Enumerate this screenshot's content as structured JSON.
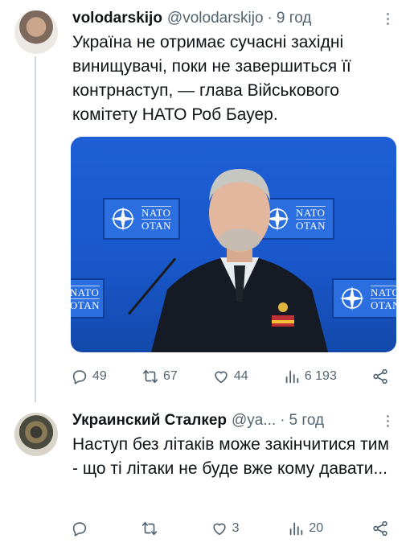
{
  "tweets": [
    {
      "author": "volodarskijo",
      "handle": "@volodarskijo",
      "separator": "·",
      "time": "9 год",
      "text": "Україна не отримає сучасні західні винищувачі, поки не завершиться її контрнаступ, — глава Військового комітету НАТО Роб Бауер.",
      "media": {
        "nato_label_top": "NATO",
        "nato_label_bottom": "OTAN"
      },
      "stats": {
        "replies": "49",
        "retweets": "67",
        "likes": "44",
        "views": "6 193"
      }
    },
    {
      "author": "Украинский Сталкер",
      "handle": "@ya...",
      "separator": "·",
      "time": "5 год",
      "text": "Наступ без літаків може закінчитися тим - що ті літаки не буде вже кому давати...",
      "stats": {
        "replies": "",
        "retweets": "",
        "likes": "3",
        "views": "20"
      }
    }
  ],
  "icons": [
    "reply-icon",
    "retweet-icon",
    "like-icon",
    "views-icon",
    "share-icon",
    "more-options-icon"
  ],
  "colors": {
    "text": "#0f1419",
    "secondary": "#536471",
    "thread_line": "#cfd9de",
    "nato_blue": "#1d5fd6"
  }
}
